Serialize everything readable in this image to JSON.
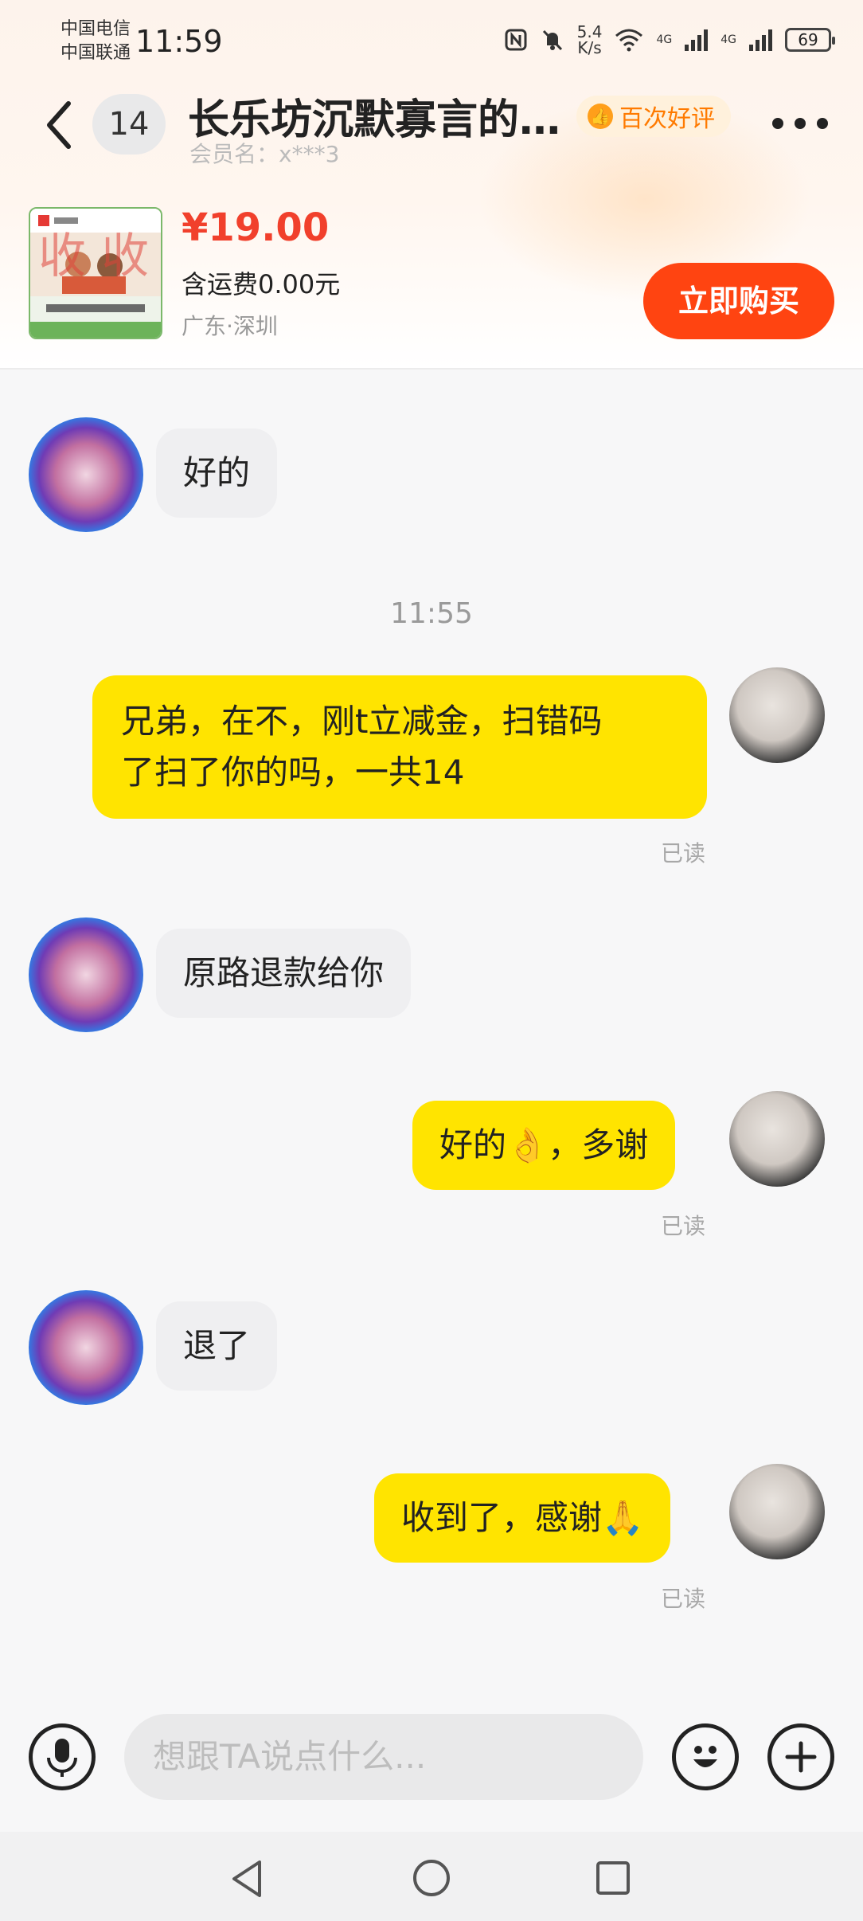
{
  "status_bar": {
    "carrier_1": "中国电信",
    "carrier_2": "中国联通",
    "time": "11:59",
    "net_speed_value": "5.4",
    "net_speed_unit": "K/s",
    "net_type_1": "4G",
    "net_type_2": "4G",
    "battery": "69"
  },
  "header": {
    "unread_count": "14",
    "title": "长乐坊沉默寡言的…",
    "member_label": "会员名：x***3",
    "rating_badge": "百次好评"
  },
  "product": {
    "price": "¥19.00",
    "shipping": "含运费0.00元",
    "location": "广东·深圳",
    "buy_button": "立即购买",
    "image_stamp": "收 收"
  },
  "messages": [
    {
      "from": "other",
      "text": "好的"
    },
    {
      "type": "time",
      "text": "11:55"
    },
    {
      "from": "me",
      "line1": "兄弟，在不，刚t立减金，扫错码",
      "line2": "了扫了你的吗，一共14",
      "read": "已读"
    },
    {
      "from": "other",
      "text": "原路退款给你"
    },
    {
      "from": "me",
      "text": "好的👌，多谢",
      "read": "已读"
    },
    {
      "from": "other",
      "text": "退了"
    },
    {
      "from": "me",
      "text": "收到了，感谢🙏",
      "read": "已读"
    }
  ],
  "input_bar": {
    "placeholder": "想跟TA说点什么..."
  },
  "icons": {
    "back": "chevron-left-icon",
    "more": "more-icon",
    "mic": "microphone-icon",
    "emoji": "emoji-icon",
    "plus": "plus-icon",
    "nav_back": "triangle-back-icon",
    "nav_home": "circle-home-icon",
    "nav_recents": "square-recents-icon"
  },
  "colors": {
    "accent_yellow": "#ffe400",
    "buy_red": "#ff4411",
    "price_red": "#f1402c",
    "rating_orange": "#ff7a00"
  }
}
